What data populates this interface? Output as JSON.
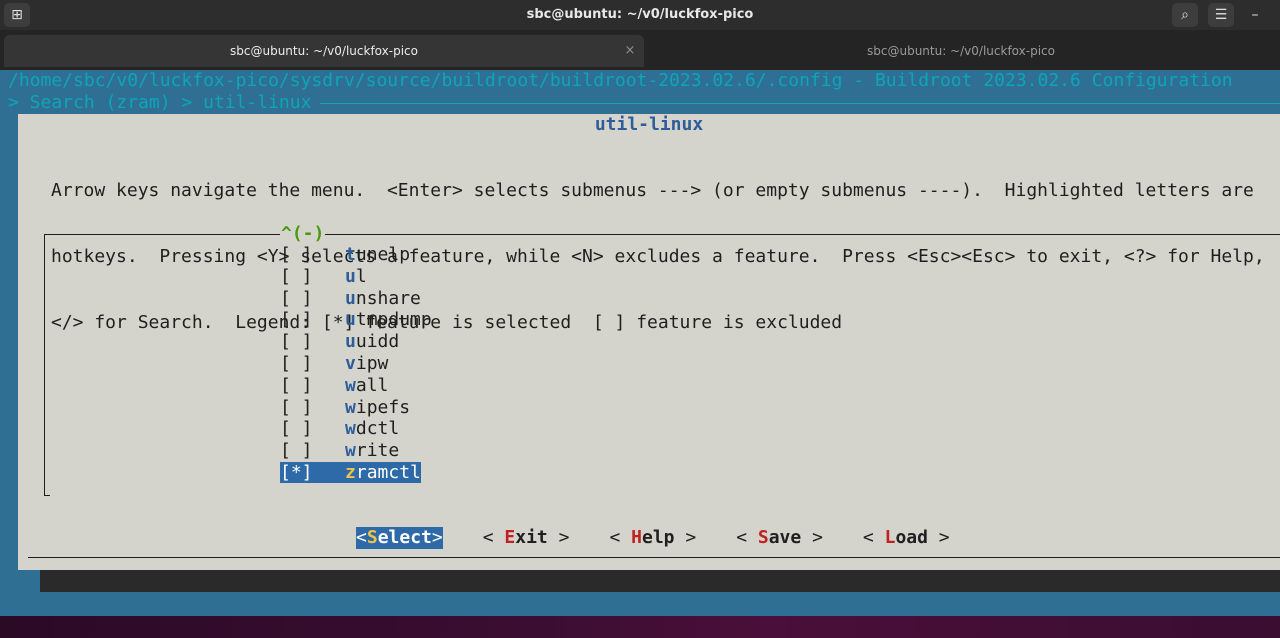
{
  "window": {
    "title": "sbc@ubuntu: ~/v0/luckfox-pico"
  },
  "tabs": [
    {
      "label": "sbc@ubuntu: ~/v0/luckfox-pico",
      "active": true
    },
    {
      "label": "sbc@ubuntu: ~/v0/luckfox-pico",
      "active": false
    }
  ],
  "tab_close_glyph": "×",
  "terminal": {
    "path_line": "/home/sbc/v0/luckfox-pico/sysdrv/source/buildroot/buildroot-2023.02.6/.config - Buildroot 2023.02.6 Configuration",
    "crumb_line": "> Search (zram) > util-linux"
  },
  "dialog": {
    "title": "util-linux",
    "help_lines": [
      "Arrow keys navigate the menu.  <Enter> selects submenus ---> (or empty submenus ----).  Highlighted letters are",
      "hotkeys.  Pressing <Y> selects a feature, while <N> excludes a feature.  Press <Esc><Esc> to exit, <?> for Help,",
      "</> for Search.  Legend: [*] feature is selected  [ ] feature is excluded"
    ],
    "scroll_indicator": "^(-)",
    "items": [
      {
        "check": "[ ]",
        "hotkey": "t",
        "rest": "unelp",
        "selected": false
      },
      {
        "check": "[ ]",
        "hotkey": "u",
        "rest": "l",
        "selected": false
      },
      {
        "check": "[ ]",
        "hotkey": "u",
        "rest": "nshare",
        "selected": false
      },
      {
        "check": "[ ]",
        "hotkey": "u",
        "rest": "tmpdump",
        "selected": false
      },
      {
        "check": "[ ]",
        "hotkey": "u",
        "rest": "uidd",
        "selected": false
      },
      {
        "check": "[ ]",
        "hotkey": "v",
        "rest": "ipw",
        "selected": false
      },
      {
        "check": "[ ]",
        "hotkey": "w",
        "rest": "all",
        "selected": false
      },
      {
        "check": "[ ]",
        "hotkey": "w",
        "rest": "ipefs",
        "selected": false
      },
      {
        "check": "[ ]",
        "hotkey": "w",
        "rest": "dctl",
        "selected": false
      },
      {
        "check": "[ ]",
        "hotkey": "w",
        "rest": "rite",
        "selected": false
      },
      {
        "check": "[*]",
        "hotkey": "z",
        "rest": "ramctl",
        "selected": true
      }
    ],
    "buttons": [
      {
        "open": "<",
        "hotkey": "S",
        "rest": "elect",
        "close": ">",
        "selected": true,
        "name": "select"
      },
      {
        "open": "< ",
        "hotkey": "E",
        "rest": "xit",
        "close": " >",
        "selected": false,
        "name": "exit"
      },
      {
        "open": "< ",
        "hotkey": "H",
        "rest": "elp",
        "close": " >",
        "selected": false,
        "name": "help"
      },
      {
        "open": "< ",
        "hotkey": "S",
        "rest": "ave",
        "close": " >",
        "selected": false,
        "name": "save"
      },
      {
        "open": "< ",
        "hotkey": "L",
        "rest": "oad",
        "close": " >",
        "selected": false,
        "name": "load"
      }
    ]
  },
  "icons": {
    "new_tab": "⊞",
    "search": "⌕",
    "menu": "☰",
    "minimize": "–"
  },
  "colors": {
    "terminal_bg": "#2f6f94",
    "dialog_bg": "#d4d4cd",
    "highlight": "#2f6aa8",
    "hotkey_blue": "#2f5d9a",
    "hotkey_red": "#c02020",
    "path_cyan": "#0ea5b8"
  }
}
